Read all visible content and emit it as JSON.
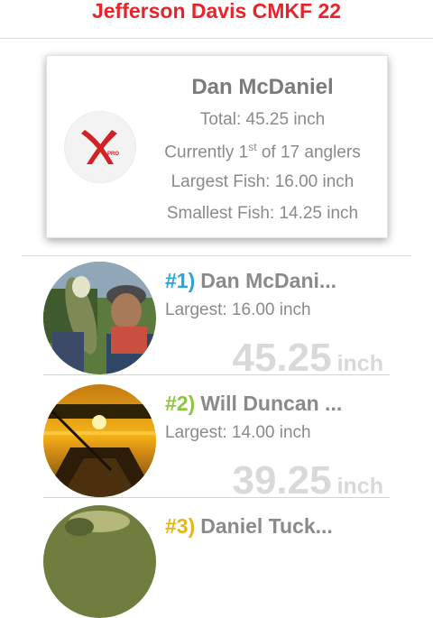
{
  "header": {
    "title": "Jefferson Davis CMKF 22"
  },
  "summary_card": {
    "logo_icon": "xpro-logo-icon",
    "name": "Dan McDaniel",
    "total": "Total: 45.25 inch",
    "standing_prefix": "Currently 1",
    "standing_suffix": "st",
    "standing_rest": " of 17 anglers",
    "largest": "Largest Fish:  16.00 inch",
    "smallest": "Smallest Fish:  14.25 inch"
  },
  "colors": {
    "title": "#e8232a",
    "rank1": "#2aa3df",
    "rank2": "#8cc63f",
    "rank3": "#e8b417"
  },
  "leaderboard": [
    {
      "rank": "#1)",
      "name": "Dan McDani...",
      "largest": "Largest:  16.00 inch",
      "total": "45.25",
      "unit": "inch",
      "rank_color": "#2aa3df"
    },
    {
      "rank": "#2)",
      "name": "Will Duncan ...",
      "largest": "Largest:  14.00 inch",
      "total": "39.25",
      "unit": "inch",
      "rank_color": "#8cc63f"
    },
    {
      "rank": "#3)",
      "name": "Daniel Tuck...",
      "rank_color": "#e8b417"
    }
  ]
}
